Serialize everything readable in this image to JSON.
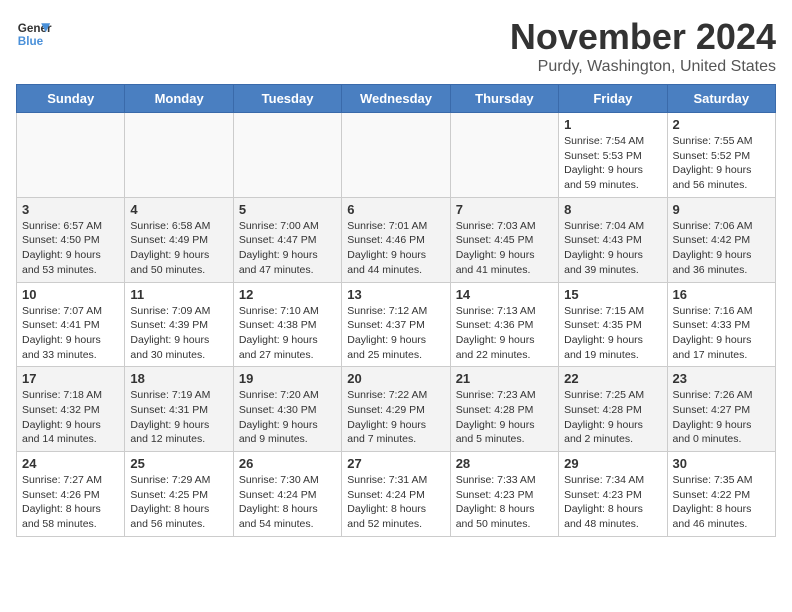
{
  "header": {
    "logo_line1": "General",
    "logo_line2": "Blue",
    "month": "November 2024",
    "location": "Purdy, Washington, United States"
  },
  "weekdays": [
    "Sunday",
    "Monday",
    "Tuesday",
    "Wednesday",
    "Thursday",
    "Friday",
    "Saturday"
  ],
  "weeks": [
    [
      {
        "day": "",
        "info": ""
      },
      {
        "day": "",
        "info": ""
      },
      {
        "day": "",
        "info": ""
      },
      {
        "day": "",
        "info": ""
      },
      {
        "day": "",
        "info": ""
      },
      {
        "day": "1",
        "info": "Sunrise: 7:54 AM\nSunset: 5:53 PM\nDaylight: 9 hours\nand 59 minutes."
      },
      {
        "day": "2",
        "info": "Sunrise: 7:55 AM\nSunset: 5:52 PM\nDaylight: 9 hours\nand 56 minutes."
      }
    ],
    [
      {
        "day": "3",
        "info": "Sunrise: 6:57 AM\nSunset: 4:50 PM\nDaylight: 9 hours\nand 53 minutes."
      },
      {
        "day": "4",
        "info": "Sunrise: 6:58 AM\nSunset: 4:49 PM\nDaylight: 9 hours\nand 50 minutes."
      },
      {
        "day": "5",
        "info": "Sunrise: 7:00 AM\nSunset: 4:47 PM\nDaylight: 9 hours\nand 47 minutes."
      },
      {
        "day": "6",
        "info": "Sunrise: 7:01 AM\nSunset: 4:46 PM\nDaylight: 9 hours\nand 44 minutes."
      },
      {
        "day": "7",
        "info": "Sunrise: 7:03 AM\nSunset: 4:45 PM\nDaylight: 9 hours\nand 41 minutes."
      },
      {
        "day": "8",
        "info": "Sunrise: 7:04 AM\nSunset: 4:43 PM\nDaylight: 9 hours\nand 39 minutes."
      },
      {
        "day": "9",
        "info": "Sunrise: 7:06 AM\nSunset: 4:42 PM\nDaylight: 9 hours\nand 36 minutes."
      }
    ],
    [
      {
        "day": "10",
        "info": "Sunrise: 7:07 AM\nSunset: 4:41 PM\nDaylight: 9 hours\nand 33 minutes."
      },
      {
        "day": "11",
        "info": "Sunrise: 7:09 AM\nSunset: 4:39 PM\nDaylight: 9 hours\nand 30 minutes."
      },
      {
        "day": "12",
        "info": "Sunrise: 7:10 AM\nSunset: 4:38 PM\nDaylight: 9 hours\nand 27 minutes."
      },
      {
        "day": "13",
        "info": "Sunrise: 7:12 AM\nSunset: 4:37 PM\nDaylight: 9 hours\nand 25 minutes."
      },
      {
        "day": "14",
        "info": "Sunrise: 7:13 AM\nSunset: 4:36 PM\nDaylight: 9 hours\nand 22 minutes."
      },
      {
        "day": "15",
        "info": "Sunrise: 7:15 AM\nSunset: 4:35 PM\nDaylight: 9 hours\nand 19 minutes."
      },
      {
        "day": "16",
        "info": "Sunrise: 7:16 AM\nSunset: 4:33 PM\nDaylight: 9 hours\nand 17 minutes."
      }
    ],
    [
      {
        "day": "17",
        "info": "Sunrise: 7:18 AM\nSunset: 4:32 PM\nDaylight: 9 hours\nand 14 minutes."
      },
      {
        "day": "18",
        "info": "Sunrise: 7:19 AM\nSunset: 4:31 PM\nDaylight: 9 hours\nand 12 minutes."
      },
      {
        "day": "19",
        "info": "Sunrise: 7:20 AM\nSunset: 4:30 PM\nDaylight: 9 hours\nand 9 minutes."
      },
      {
        "day": "20",
        "info": "Sunrise: 7:22 AM\nSunset: 4:29 PM\nDaylight: 9 hours\nand 7 minutes."
      },
      {
        "day": "21",
        "info": "Sunrise: 7:23 AM\nSunset: 4:28 PM\nDaylight: 9 hours\nand 5 minutes."
      },
      {
        "day": "22",
        "info": "Sunrise: 7:25 AM\nSunset: 4:28 PM\nDaylight: 9 hours\nand 2 minutes."
      },
      {
        "day": "23",
        "info": "Sunrise: 7:26 AM\nSunset: 4:27 PM\nDaylight: 9 hours\nand 0 minutes."
      }
    ],
    [
      {
        "day": "24",
        "info": "Sunrise: 7:27 AM\nSunset: 4:26 PM\nDaylight: 8 hours\nand 58 minutes."
      },
      {
        "day": "25",
        "info": "Sunrise: 7:29 AM\nSunset: 4:25 PM\nDaylight: 8 hours\nand 56 minutes."
      },
      {
        "day": "26",
        "info": "Sunrise: 7:30 AM\nSunset: 4:24 PM\nDaylight: 8 hours\nand 54 minutes."
      },
      {
        "day": "27",
        "info": "Sunrise: 7:31 AM\nSunset: 4:24 PM\nDaylight: 8 hours\nand 52 minutes."
      },
      {
        "day": "28",
        "info": "Sunrise: 7:33 AM\nSunset: 4:23 PM\nDaylight: 8 hours\nand 50 minutes."
      },
      {
        "day": "29",
        "info": "Sunrise: 7:34 AM\nSunset: 4:23 PM\nDaylight: 8 hours\nand 48 minutes."
      },
      {
        "day": "30",
        "info": "Sunrise: 7:35 AM\nSunset: 4:22 PM\nDaylight: 8 hours\nand 46 minutes."
      }
    ]
  ]
}
